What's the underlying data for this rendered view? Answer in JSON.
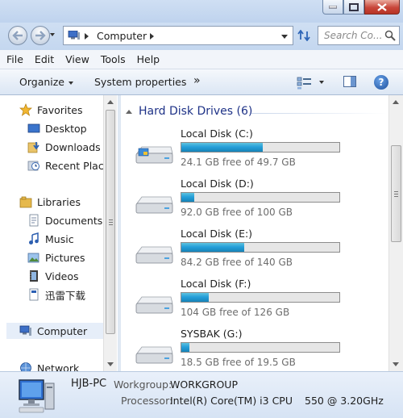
{
  "address": {
    "location": "Computer"
  },
  "search": {
    "placeholder": "Search Co..."
  },
  "menu": [
    "File",
    "Edit",
    "View",
    "Tools",
    "Help"
  ],
  "toolbar": {
    "organize": "Organize",
    "system_properties": "System properties",
    "more": "»"
  },
  "nav": {
    "favorites": "Favorites",
    "desktop": "Desktop",
    "downloads": "Downloads",
    "recent_places": "Recent Place",
    "libraries": "Libraries",
    "documents": "Documents",
    "music": "Music",
    "pictures": "Pictures",
    "videos": "Videos",
    "xunlei": "迅雷下载",
    "computer": "Computer",
    "network": "Network"
  },
  "content": {
    "group_title": "Hard Disk Drives (6)",
    "drives": [
      {
        "name": "Local Disk (C:)",
        "free_text": "24.1 GB free of 49.7 GB",
        "used_fraction": 0.515
      },
      {
        "name": "Local Disk (D:)",
        "free_text": "92.0 GB free of 100 GB",
        "used_fraction": 0.08
      },
      {
        "name": "Local Disk (E:)",
        "free_text": "84.2 GB free of 140 GB",
        "used_fraction": 0.399
      },
      {
        "name": "Local Disk (F:)",
        "free_text": "104 GB free of 126 GB",
        "used_fraction": 0.175
      },
      {
        "name": "SYSBAK (G:)",
        "free_text": "18.5 GB free of 19.5 GB",
        "used_fraction": 0.051
      }
    ]
  },
  "details": {
    "computer_name": "HJB-PC",
    "workgroup_label": "Workgroup:",
    "workgroup_value": "WORKGROUP",
    "processor_label": "Processor:",
    "processor_value": "Intel(R) Core(TM) i3 CPU",
    "processor_tail": "550  @ 3.20GHz"
  },
  "colors": {
    "accent": "#1e3287",
    "bar_fill": "#26a0da"
  }
}
